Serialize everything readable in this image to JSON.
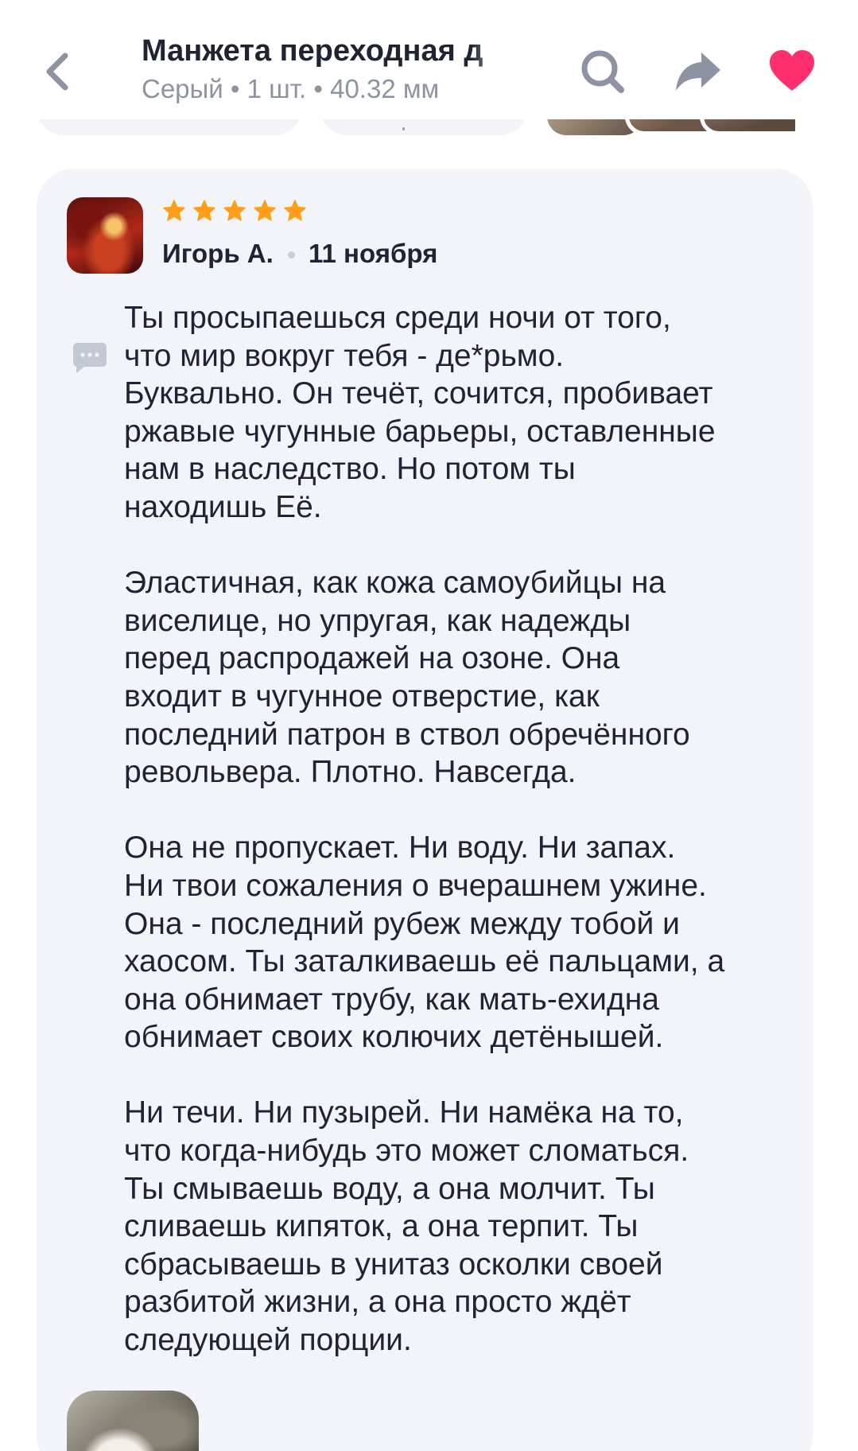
{
  "header": {
    "title": "Манжета переходная д",
    "subtitle": "Серый • 1 шт. • 40.32 мм",
    "back_icon": "chevron-left-icon",
    "search_icon": "search-icon",
    "share_icon": "share-arrow-icon",
    "favorite_icon": "heart-icon",
    "favorite_color": "#ff2e6f"
  },
  "review": {
    "author": "Игорь А.",
    "date": "11 ноября",
    "rating": 5,
    "star_color": "#ff9e16",
    "paragraphs": [
      [
        "Ты просыпаешься среди ночи от того,",
        "что мир вокруг тебя - де*рьмо.",
        "Буквально. Он течёт, сочится, пробивает",
        "ржавые чугунные барьеры, оставленные",
        "нам в наследство. Но потом ты",
        "находишь Её."
      ],
      [
        "Эластичная, как кожа самоубийцы на",
        "виселице, но упругая, как надежды",
        "перед распродажей на озоне. Она",
        "входит в чугунное отверстие, как",
        "последний патрон в ствол обречённого",
        "револьвера. Плотно. Навсегда."
      ],
      [
        "Она не пропускает. Ни воду. Ни запах.",
        "Ни твои сожаления о вчерашнем ужине.",
        "Она - последний рубеж между тобой и",
        "хаосом. Ты заталкиваешь её пальцами, а",
        "она обнимает трубу, как мать-ехидна",
        "обнимает своих колючих детёнышей."
      ],
      [
        "Ни течи. Ни пузырей. Ни намёка на то,",
        "что когда-нибудь это может сломаться.",
        "Ты смываешь воду, а она молчит. Ты",
        "сливаешь кипяток, а она терпит. Ты",
        "сбрасываешь в унитаз осколки своей",
        "разбитой жизни, а она просто ждёт",
        "следующей порции."
      ]
    ]
  }
}
